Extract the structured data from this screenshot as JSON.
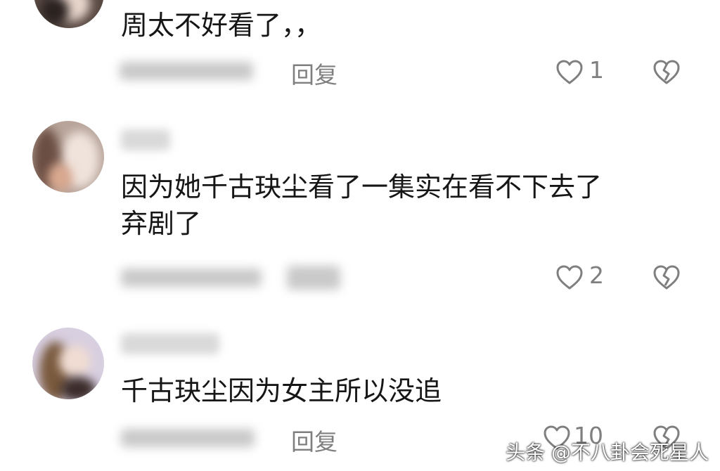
{
  "comments": [
    {
      "text": "周太不好看了，，",
      "reply_label": "回复",
      "like_count": "1",
      "like_icon": "heart-outline-icon",
      "dislike_icon": "broken-heart-icon"
    },
    {
      "text": "因为她千古玦尘看了一集实在看不下去了\n弃剧了",
      "like_count": "2",
      "like_icon": "heart-outline-icon",
      "dislike_icon": "broken-heart-icon"
    },
    {
      "text": "千古玦尘因为女主所以没追",
      "reply_label": "回复",
      "like_count": "10",
      "like_icon": "heart-outline-icon",
      "dislike_icon": "broken-heart-icon"
    }
  ],
  "watermark": "头条 @不八卦会死星人",
  "colors": {
    "text": "#161616",
    "meta": "#7f7f7f",
    "background": "#ffffff"
  }
}
